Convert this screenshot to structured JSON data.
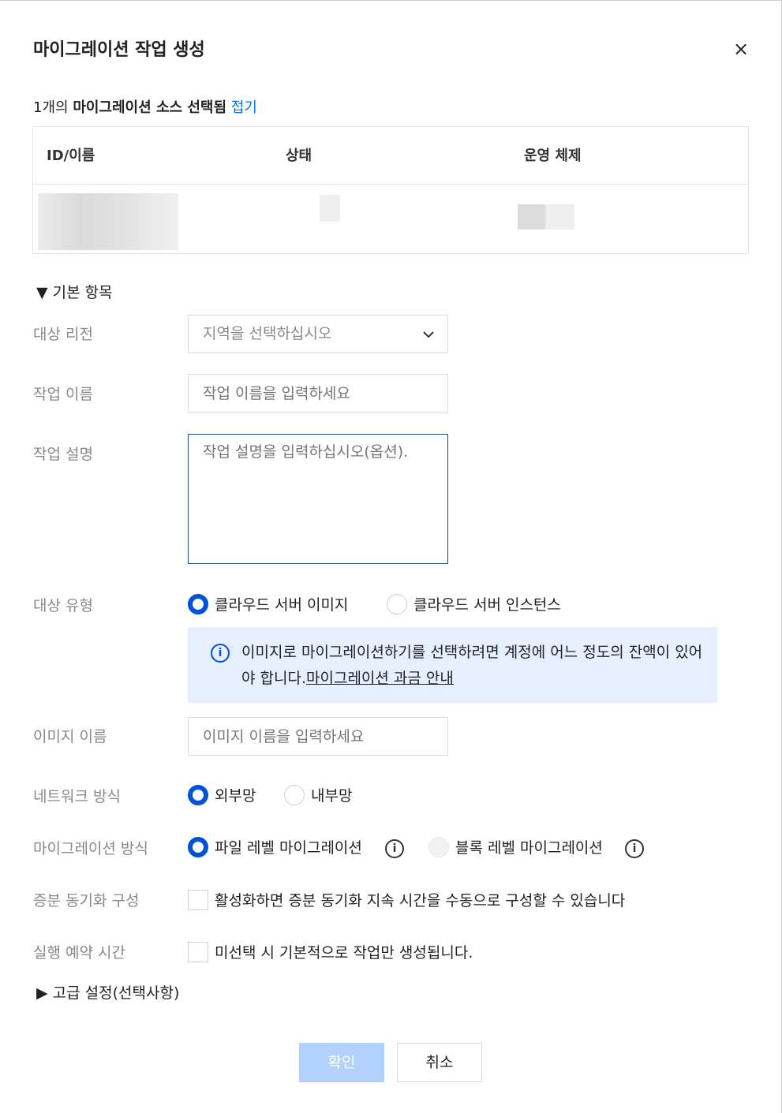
{
  "dialog": {
    "title": "마이그레이션 작업 생성",
    "close_label": "×"
  },
  "selection": {
    "count": "1개의",
    "text": "마이그레이션 소스 선택됨",
    "collapse_link": "접기"
  },
  "table": {
    "columns": [
      "ID/이름",
      "상태",
      "운영 체제"
    ]
  },
  "basic_section": {
    "label": "▼ 기본 항목"
  },
  "form": {
    "region": {
      "label": "대상 리전",
      "placeholder": "지역을 선택하십시오",
      "caret": "⌄"
    },
    "job_name": {
      "label": "작업 이름",
      "placeholder": "작업 이름을 입력하세요"
    },
    "job_desc": {
      "label": "작업 설명",
      "placeholder": "작업 설명을 입력하십시오(옵션)."
    },
    "target_type": {
      "label": "대상 유형",
      "options": [
        "클라우드 서버 이미지",
        "클라우드 서버 인스턴스"
      ],
      "selected": "클라우드 서버 이미지"
    },
    "notice": {
      "icon": "info-icon",
      "text": "이미지로 마이그레이션하기를 선택하려면 계정에 어느 정도의 잔액이 있어야 합니다.",
      "link": "마이그레이션 과금 안내"
    },
    "image_name": {
      "label": "이미지 이름",
      "placeholder": "이미지 이름을 입력하세요"
    },
    "network": {
      "label": "네트워크 방식",
      "options": [
        "외부망",
        "내부망"
      ],
      "selected": "외부망"
    },
    "migration_mode": {
      "label": "마이그레이션 방식",
      "options": [
        "파일 레벨 마이그레이션",
        "블록 레벨 마이그레이션"
      ],
      "selected": "파일 레벨 마이그레이션",
      "info_glyph": "i"
    },
    "incremental": {
      "label": "증분 동기화 구성",
      "text": "활성화하면 증분 동기화 지속 시간을 수동으로 구성할 수 있습니다"
    },
    "schedule": {
      "label": "실행 예약 시간",
      "text": "미선택 시 기본적으로 작업만 생성됩니다."
    }
  },
  "advanced_section": {
    "label": "▶ 고급 설정(선택사항)"
  },
  "footer": {
    "confirm_label": "확인",
    "cancel_label": "취소"
  },
  "colors": {
    "primary": "#0052d9",
    "link": "#006eff",
    "notice_bg": "#e5efff",
    "confirm_disabled": "#b3d1fd"
  }
}
